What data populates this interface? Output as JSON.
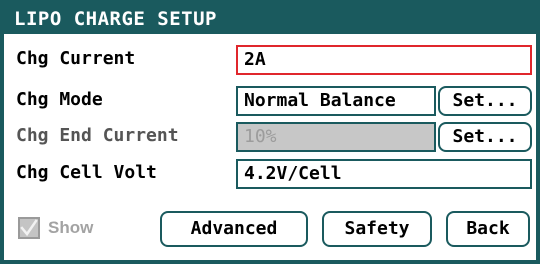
{
  "window": {
    "title": "LIPO CHARGE SETUP"
  },
  "rows": [
    {
      "label": "Chg Current",
      "value": "2A"
    },
    {
      "label": "Chg Mode",
      "value": "Normal Balance",
      "button": "Set..."
    },
    {
      "label": "Chg End Current",
      "value": "10%",
      "button": "Set..."
    },
    {
      "label": "Chg Cell Volt",
      "value": "4.2V/Cell"
    }
  ],
  "footer": {
    "show_label": "Show",
    "show_checked": true,
    "advanced_label": "Advanced",
    "safety_label": "Safety",
    "back_label": "Back"
  },
  "colors": {
    "frame": "#1a5a5e",
    "active_border": "#e0262c",
    "disabled_fill": "#c7c7c7"
  }
}
